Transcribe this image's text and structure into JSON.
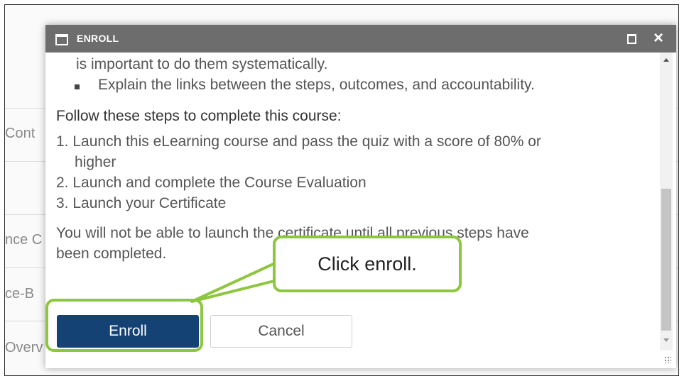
{
  "background": {
    "row_labels": [
      "Cont",
      "nce C",
      "ce-B",
      "Overv"
    ]
  },
  "dialog": {
    "title": "ENROLL",
    "title_icon": "window-icon",
    "maximize_icon": "maximize-icon",
    "close_icon": "close-icon",
    "close_glyph": "×",
    "content": {
      "cut_line": "is important to do them systematically.",
      "bullet": "Explain the links between the steps, outcomes, and accountability.",
      "steps_heading": "Follow these steps to complete this course:",
      "steps": [
        "1. Launch this eLearning course and pass the quiz with a score of 80% or",
        "higher",
        "2. Launch and complete the Course Evaluation",
        "3. Launch your Certificate"
      ],
      "note_line1": "You will not be able to launch the certificate until all previous steps have",
      "note_line2": "been completed."
    },
    "buttons": {
      "enroll": "Enroll",
      "cancel": "Cancel"
    }
  },
  "callout": {
    "text": "Click enroll.",
    "border_color": "#8dc63f"
  },
  "colors": {
    "titlebar": "#6d6d6d",
    "enroll_button": "#144274"
  }
}
